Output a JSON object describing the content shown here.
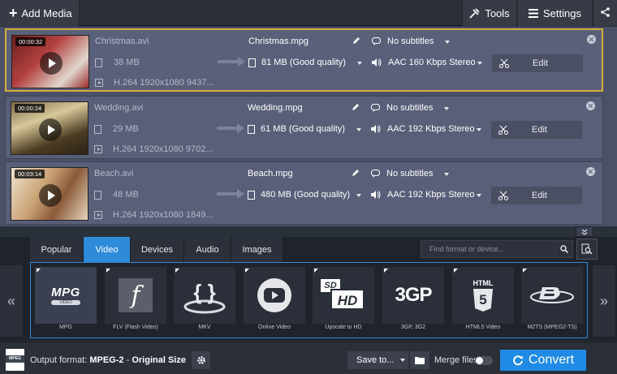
{
  "toolbar": {
    "add_media_label": "Add Media",
    "tools_label": "Tools",
    "settings_label": "Settings"
  },
  "files": [
    {
      "duration": "00:00:32",
      "name": "Christmas.avi",
      "size": "38 MB",
      "codec": "H.264 1920x1080 9437...",
      "output_name": "Christmas.mpg",
      "output_size": "81 MB (Good quality)",
      "subtitles": "No subtitles",
      "audio": "AAC 160 Kbps Stereo",
      "edit_label": "Edit",
      "thumb_colors": [
        "#8b2a2a",
        "#d9d2c8"
      ]
    },
    {
      "duration": "00:00:24",
      "name": "Wedding.avi",
      "size": "29 MB",
      "codec": "H.264 1920x1080 9702...",
      "output_name": "Wedding.mpg",
      "output_size": "61 MB (Good quality)",
      "subtitles": "No subtitles",
      "audio": "AAC 192 Kbps Stereo",
      "edit_label": "Edit",
      "thumb_colors": [
        "#5a4a2c",
        "#c9b98a"
      ]
    },
    {
      "duration": "00:03:14",
      "name": "Beach.avi",
      "size": "48 MB",
      "codec": "H.264 1920x1080 1849...",
      "output_name": "Beach.mpg",
      "output_size": "480 MB (Good quality)",
      "subtitles": "No subtitles",
      "audio": "AAC 192 Kbps Stereo",
      "edit_label": "Edit",
      "thumb_colors": [
        "#c9a070",
        "#e9dcc6"
      ]
    }
  ],
  "tabs": [
    "Popular",
    "Video",
    "Devices",
    "Audio",
    "Images"
  ],
  "active_tab": "Video",
  "search": {
    "placeholder": "Find format or device..."
  },
  "formats": [
    {
      "label": "MPG",
      "icon": "mpg-logo",
      "logo_text": "MPG",
      "logo_sub": "VIDEO"
    },
    {
      "label": "FLV (Flash Video)",
      "icon": "flash-logo",
      "logo_text": "f"
    },
    {
      "label": "MKV",
      "icon": "mkv-logo",
      "logo_text": "{ }"
    },
    {
      "label": "Online Video",
      "icon": "youtube-logo"
    },
    {
      "label": "Upscale to HD",
      "icon": "hd-logo",
      "logo_text": "SD",
      "logo_sub": "HD"
    },
    {
      "label": "3GP, 3G2",
      "icon": "3gp-logo",
      "logo_text": "3GP"
    },
    {
      "label": "HTML5 Video",
      "icon": "html5-logo",
      "logo_text": "HTML",
      "logo_sub": "5"
    },
    {
      "label": "M2TS (MPEG2-TS)",
      "icon": "bluray-logo"
    }
  ],
  "bottom": {
    "output_prefix": "Output format:",
    "output_format": "MPEG-2",
    "output_sep": " - ",
    "output_size": "Original Size",
    "output_icon_text": "MPEG",
    "save_to": "Save to...",
    "merge_label": "Merge files",
    "convert_label": "Convert"
  },
  "colors": {
    "accent": "#2e8bd9",
    "convert": "#1f8be6",
    "selection_border": "#d6ad3e"
  }
}
